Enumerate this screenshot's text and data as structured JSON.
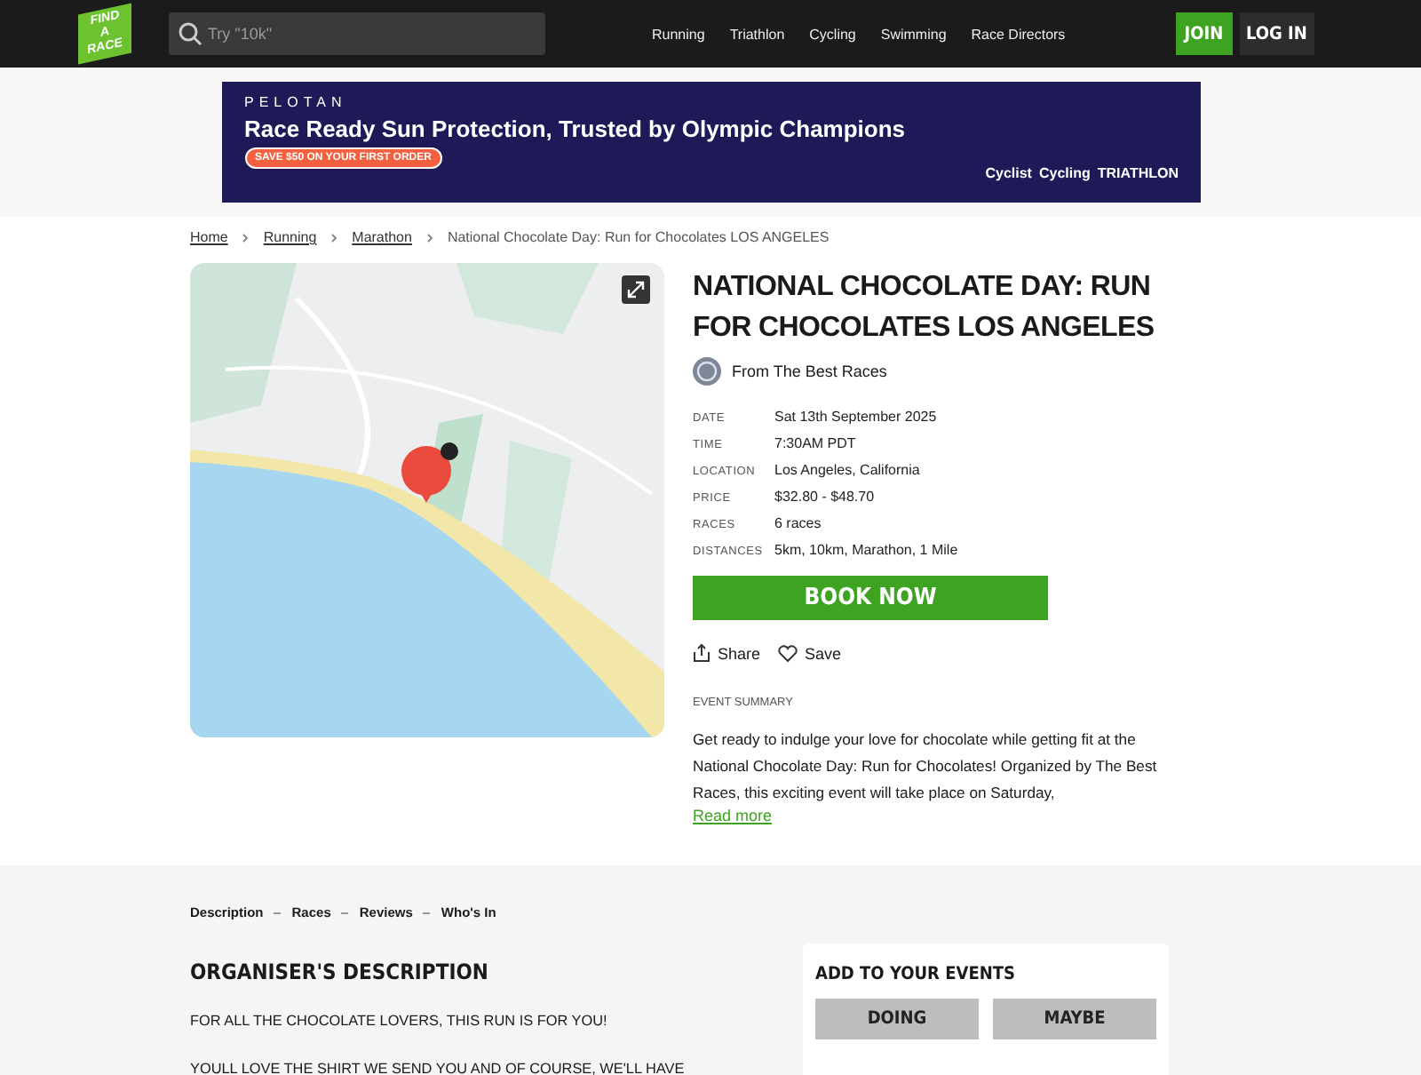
{
  "header": {
    "logo": [
      "FIND",
      "A",
      "RACE"
    ],
    "search": {
      "placeholder": "Try \"10k\""
    },
    "nav": [
      "Running",
      "Triathlon",
      "Cycling",
      "Swimming",
      "Race Directors"
    ],
    "join": "JOIN",
    "login": "LOG IN"
  },
  "ad": {
    "brand": "PELOTAN",
    "headline": "Race Ready Sun Protection, Trusted by Olympic Champions",
    "cta": "SAVE $50 ON YOUR FIRST ORDER",
    "logos": [
      "Cyclist",
      "Cycling",
      "TRIATHLON"
    ]
  },
  "breadcrumbs": [
    "Home",
    "Running",
    "Marathon",
    "National Chocolate Day: Run for Chocolates LOS ANGELES"
  ],
  "map": {
    "kind": "picture"
  },
  "event": {
    "title": "NATIONAL CHOCOLATE DAY: RUN FOR CHOCOLATES LOS ANGELES",
    "organiser": "From The Best Races",
    "details": [
      {
        "label": "DATE",
        "value": "Sat 13th September 2025"
      },
      {
        "label": "TIME",
        "value": "7:30AM PDT"
      },
      {
        "label": "LOCATION",
        "value": "Los Angeles, California"
      },
      {
        "label": "PRICE",
        "value": "$32.80 - $48.70"
      },
      {
        "label": "RACES",
        "value": "6 races"
      },
      {
        "label": "DISTANCES",
        "value": "5km, 10km, Marathon, 1 Mile"
      }
    ],
    "book": "BOOK NOW",
    "share": "Share",
    "save": "Save",
    "summary_label": "EVENT SUMMARY",
    "summary": "Get ready to indulge your love for chocolate while getting fit at the National Chocolate Day: Run for Chocolates! Organized by The Best Races, this exciting event will take place on Saturday,",
    "read_more": "Read more"
  },
  "section_tabs": [
    "Description",
    "Races",
    "Reviews",
    "Who's In"
  ],
  "description": {
    "heading": "ORGANISER'S DESCRIPTION",
    "paragraphs": [
      "FOR ALL THE CHOCOLATE LOVERS, THIS RUN IS FOR YOU!",
      "YOULL LOVE THE SHIRT WE SEND YOU AND OF COURSE, WE'LL HAVE"
    ]
  },
  "add_events": {
    "heading": "ADD TO YOUR EVENTS",
    "buttons": [
      "DOING",
      "MAYBE"
    ]
  }
}
